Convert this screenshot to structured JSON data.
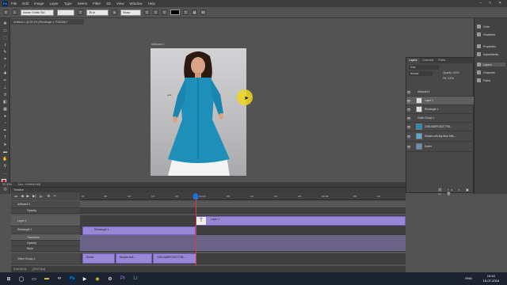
{
  "app": {
    "logo": "Ps"
  },
  "menu": [
    "File",
    "Edit",
    "Image",
    "Layer",
    "Type",
    "Select",
    "Filter",
    "3D",
    "View",
    "Window",
    "Help"
  ],
  "options_bar": {
    "font_family": "Adobe Gothic Std",
    "font_style": "-",
    "font_size": "36 pt",
    "antialias": "Sharp"
  },
  "document_tab": "Untitled-1 @ 33.3% (Rectangle 1, RGB/8#) *",
  "artboard": {
    "label": "Artboard 1",
    "overlay_text": "pink"
  },
  "status_bar": {
    "zoom": "33.33%",
    "doc_info": "Doc: 4.00M/11.6M"
  },
  "timeline": {
    "title": "Timeline",
    "ticks": [
      "00",
      "05f",
      "10f",
      "15f",
      "20f",
      "01:00f",
      "05f",
      "10f",
      "15f",
      "20f",
      "02:00f",
      "05f",
      "10f"
    ],
    "rows": [
      {
        "label": "Artboard 1"
      },
      {
        "label": "Opacity"
      },
      {
        "label": "Layer 1"
      },
      {
        "label": "Rectangle 1"
      },
      {
        "label": "Transform"
      },
      {
        "label": "Opacity"
      },
      {
        "label": "Style"
      },
      {
        "label": "Video Group 1"
      }
    ],
    "clips": {
      "layer1": "Layer 1",
      "rect1": "Rectangle 1",
      "vg_a": "Surfer",
      "vg_b": "Simple-soft...",
      "vg_c": "2394-588PG3027798..."
    },
    "footer": "0:00:00:01",
    "fps": "(29.97 fps)"
  },
  "layers_panel": {
    "tabs": [
      "Layers",
      "Channels",
      "Paths"
    ],
    "blend_mode": "Normal",
    "opacity": "Opacity: 100%",
    "fill": "Fill: 100%",
    "layers": [
      {
        "name": "Artboard 1"
      },
      {
        "name": "Layer 1"
      },
      {
        "name": "Rectangle 1"
      },
      {
        "name": "Video Group 1"
      },
      {
        "name": "2394-588PG3027798..."
      },
      {
        "name": "Simple-soft-sky-blue-frills-..."
      },
      {
        "name": "Surfer"
      }
    ]
  },
  "side_dock": [
    "Color",
    "Swatches",
    "Properties",
    "Adjustments",
    "Layers",
    "Channels",
    "Paths"
  ],
  "taskbar": {
    "lang": "ENG",
    "time": "19:15",
    "date": "15-07-2018"
  },
  "colors": {
    "accent": "#1473e6",
    "clip": "#9886d6",
    "playhead": "#e03c3c"
  }
}
